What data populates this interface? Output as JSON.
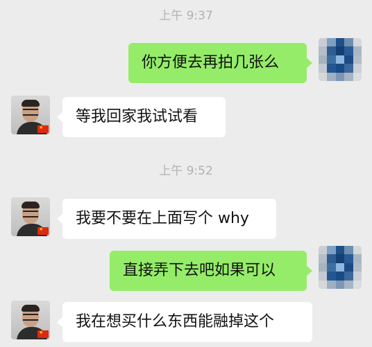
{
  "chat": {
    "timestamp_1": "上午 9:37",
    "timestamp_2": "上午 9:52",
    "messages": [
      {
        "side": "right",
        "text": "你方便去再拍几张么"
      },
      {
        "side": "left",
        "text": "等我回家我试试看"
      },
      {
        "side": "left",
        "text": "我要不要在上面写个 why"
      },
      {
        "side": "right",
        "text": "直接弄下去吧如果可以"
      },
      {
        "side": "left",
        "text": "我在想买什么东西能融掉这个"
      }
    ]
  },
  "colors": {
    "background": "#ececec",
    "outgoing_bubble": "#95ec69",
    "incoming_bubble": "#ffffff",
    "timestamp_text": "#b1b1b1"
  },
  "icons": {
    "my_avatar": "pixelated-avatar-icon",
    "contact_avatar": "contact-avatar-icon",
    "contact_flag": "china-flag-icon"
  }
}
